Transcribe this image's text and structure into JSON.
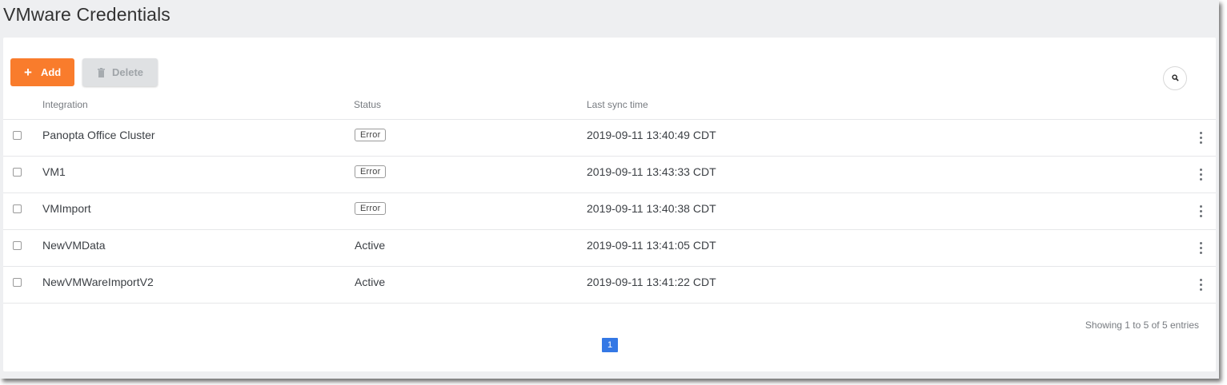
{
  "page": {
    "title": "VMware Credentials"
  },
  "toolbar": {
    "add_label": "Add",
    "add_icon": "plus-icon",
    "delete_label": "Delete",
    "delete_icon": "trash-icon",
    "search_icon": "search-icon",
    "add_color": "#f97c2c"
  },
  "table": {
    "columns": [
      "Integration",
      "Status",
      "Last sync time"
    ],
    "rows": [
      {
        "integration": "Panopta Office Cluster",
        "status": "Error",
        "status_style": "badge",
        "last_sync": "2019-09-11 13:40:49 CDT"
      },
      {
        "integration": "VM1",
        "status": "Error",
        "status_style": "badge",
        "last_sync": "2019-09-11 13:43:33 CDT"
      },
      {
        "integration": "VMImport",
        "status": "Error",
        "status_style": "badge",
        "last_sync": "2019-09-11 13:40:38 CDT"
      },
      {
        "integration": "NewVMData",
        "status": "Active",
        "status_style": "text",
        "last_sync": "2019-09-11 13:41:05 CDT"
      },
      {
        "integration": "NewVMWareImportV2",
        "status": "Active",
        "status_style": "text",
        "last_sync": "2019-09-11 13:41:22 CDT"
      }
    ],
    "row_menu_icon": "kebab-menu-icon"
  },
  "footer": {
    "summary": "Showing 1 to 5 of 5 entries",
    "current_page": "1",
    "page_color": "#3478e5"
  }
}
